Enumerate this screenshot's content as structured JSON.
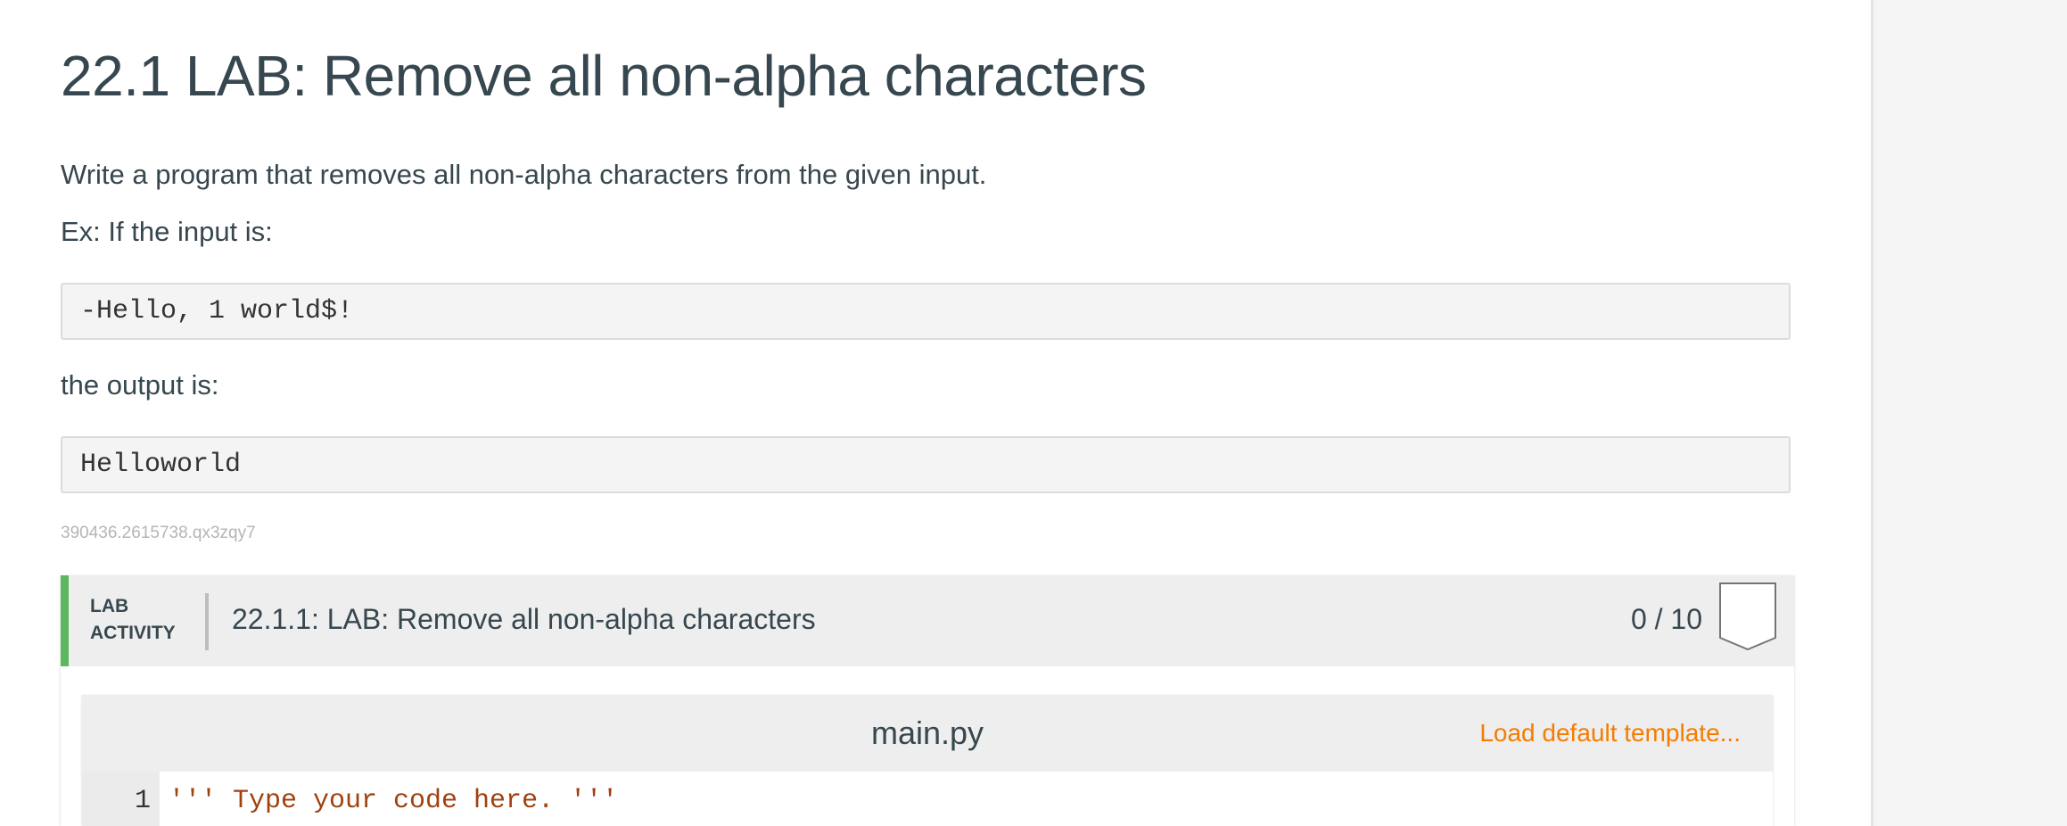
{
  "page": {
    "title": "22.1 LAB: Remove all non-alpha characters"
  },
  "description": {
    "line1": "Write a program that removes all non-alpha characters from the given input.",
    "line2": "Ex: If the input is:",
    "example_input": "-Hello, 1 world$!",
    "line3": "the output is:",
    "example_output": "Helloworld",
    "activity_id": "390436.2615738.qx3zqy7"
  },
  "lab": {
    "tag_line1": "LAB",
    "tag_line2": "ACTIVITY",
    "title": "22.1.1: LAB: Remove all non-alpha characters",
    "score": "0 / 10",
    "badge_icon": "shield-badge-icon",
    "accent_color": "#5cb85c"
  },
  "editor": {
    "file_name": "main.py",
    "load_template_label": "Load default template...",
    "lines": [
      {
        "number": "1",
        "code": "''' Type your code here. '''"
      }
    ]
  },
  "colors": {
    "link_orange": "#f57c00",
    "string_color": "#a0410d",
    "text": "#37474f"
  }
}
